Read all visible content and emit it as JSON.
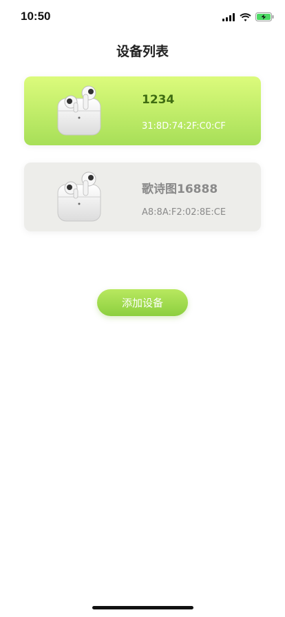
{
  "status_bar": {
    "time": "10:50",
    "icons": [
      "cellular-signal-icon",
      "wifi-icon",
      "battery-charging-icon"
    ]
  },
  "header": {
    "title": "设备列表"
  },
  "devices": [
    {
      "name": "1234",
      "mac": "31:8D:74:2F:C0:CF",
      "state": "connected"
    },
    {
      "name": "歌诗图16888",
      "mac": "A8:8A:F2:02:8E:CE",
      "state": "disconnected"
    }
  ],
  "actions": {
    "add_label": "添加设备"
  },
  "colors": {
    "accent_top": "#dcfb7c",
    "accent_bottom": "#a7df58",
    "inactive_card": "#ededea",
    "active_name": "#3f6c12",
    "inactive_text": "#8a8a8a"
  }
}
